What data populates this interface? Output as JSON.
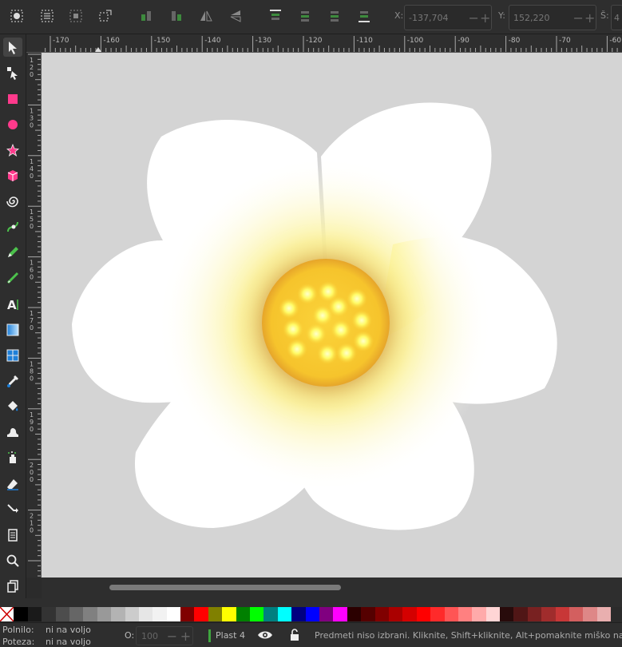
{
  "toolbar": {
    "x_label": "X:",
    "x_value": "-137,704",
    "y_label": "Y:",
    "y_value": "152,220",
    "w_label": "Š:",
    "w_value": "4"
  },
  "ruler": {
    "h_ticks": [
      "-170",
      "-160",
      "-150",
      "-140",
      "-130",
      "-120",
      "-110",
      "-100",
      "-90",
      "-80",
      "-70",
      "-60"
    ],
    "v_ticks": [
      {
        "chars": [
          "1",
          "2",
          "0"
        ]
      },
      {
        "chars": [
          "1",
          "3",
          "0"
        ]
      },
      {
        "chars": [
          "1",
          "4",
          "0"
        ]
      },
      {
        "chars": [
          "1",
          "5",
          "0"
        ]
      },
      {
        "chars": [
          "1",
          "6",
          "0"
        ]
      },
      {
        "chars": [
          "1",
          "7",
          "0"
        ]
      },
      {
        "chars": [
          "1",
          "8",
          "0"
        ]
      },
      {
        "chars": [
          "1",
          "9",
          "0"
        ]
      },
      {
        "chars": [
          "2",
          "0",
          "0"
        ]
      },
      {
        "chars": [
          "2",
          "1",
          "0"
        ]
      }
    ]
  },
  "palette": [
    "#ffffff",
    "#000000",
    "#1a1a1a",
    "#333333",
    "#4d4d4d",
    "#666666",
    "#808080",
    "#999999",
    "#b3b3b3",
    "#cccccc",
    "#e6e6e6",
    "#f2f2f2",
    "#ffffff",
    "#800000",
    "#ff0000",
    "#808000",
    "#ffff00",
    "#008000",
    "#00ff00",
    "#008080",
    "#00ffff",
    "#000080",
    "#0000ff",
    "#800080",
    "#ff00ff",
    "#2b0000",
    "#550000",
    "#800000",
    "#aa0000",
    "#d40000",
    "#ff0000",
    "#ff2a2a",
    "#ff5555",
    "#ff8080",
    "#ffaaaa",
    "#ffd5d5",
    "#280b0b",
    "#501616",
    "#782121",
    "#a02c2c",
    "#c83737",
    "#d35f5f",
    "#de8787",
    "#e9afaf"
  ],
  "status": {
    "fill_label": "Polnilo:",
    "fill_value": "ni na voljo",
    "stroke_label": "Poteza:",
    "stroke_value": "ni na voljo",
    "opacity_label": "O:",
    "opacity_value": "100",
    "layer_name": "Plast 4",
    "message": "Predmeti niso izbrani. Kliknite, Shift+kliknite, Alt+pomaknite miško na vrh"
  }
}
